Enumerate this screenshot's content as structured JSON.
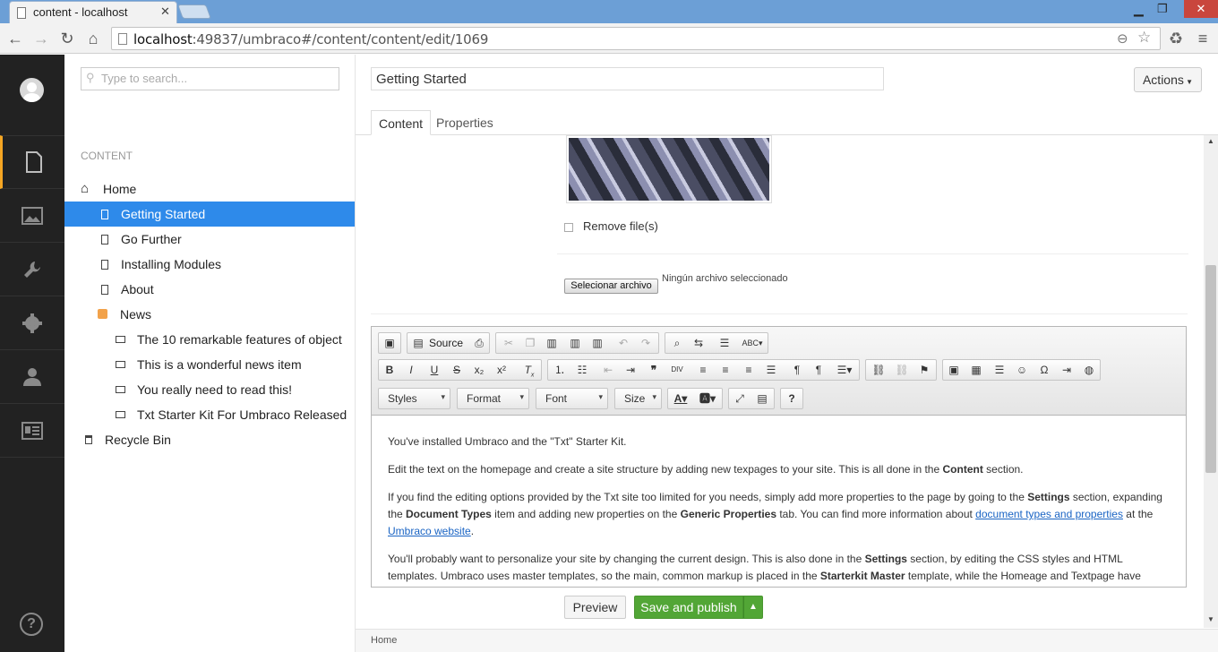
{
  "browser": {
    "tab_title": "content - localhost",
    "url_host": "localhost",
    "url_rest": ":49837/umbraco#/content/content/edit/1069"
  },
  "tree": {
    "search_placeholder": "Type to search...",
    "section_heading": "CONTENT",
    "items": [
      {
        "label": "Home",
        "icon": "home-icon"
      },
      {
        "label": "Getting Started",
        "icon": "document-icon"
      },
      {
        "label": "Go Further",
        "icon": "document-icon"
      },
      {
        "label": "Installing Modules",
        "icon": "document-icon"
      },
      {
        "label": "About",
        "icon": "document-icon"
      },
      {
        "label": "News",
        "icon": "news-icon"
      },
      {
        "label": "The 10 remarkable features of object",
        "icon": "picture-icon"
      },
      {
        "label": "This is a wonderful news item",
        "icon": "picture-icon"
      },
      {
        "label": "You really need to read this!",
        "icon": "picture-icon"
      },
      {
        "label": "Txt Starter Kit For Umbraco Released",
        "icon": "picture-icon"
      },
      {
        "label": "Recycle Bin",
        "icon": "trash-icon"
      }
    ]
  },
  "content": {
    "name": "Getting Started",
    "actions_label": "Actions",
    "tabs": [
      "Content",
      "Properties"
    ],
    "remove_files_label": "Remove file(s)",
    "file_button": "Selecionar archivo",
    "file_status": "Ningún archivo seleccionado"
  },
  "editor": {
    "source_label": "Source",
    "combos": [
      "Styles",
      "Format",
      "Font",
      "Size"
    ],
    "p1": "You've installed Umbraco and the \"Txt\" Starter Kit.",
    "p2_a": "Edit the text on the homepage and create a site structure by adding new texpages to your site. This is all done in the ",
    "p2_b": "Content",
    "p2_c": " section.",
    "p3_a": "If you find the editing options provided by the Txt site too limited for you needs, simply add more properties to the page by going to the ",
    "p3_b": "Settings",
    "p3_c": " section, expanding the ",
    "p3_d": "Document Types",
    "p3_e": " item and adding new properties on the ",
    "p3_f": "Generic Properties",
    "p3_g": " tab. You can find more information about ",
    "p3_link1": "document types and properties",
    "p3_h": " at the ",
    "p3_link2": "Umbraco website",
    "p3_i": ".",
    "p4_a": "You'll probably want to personalize your site by changing the current design. This is also done in the ",
    "p4_b": "Settings",
    "p4_c": " section, by editing the CSS styles and HTML templates. Umbraco uses master templates, so the main, common markup is placed in the ",
    "p4_d": "Starterkit Master",
    "p4_e": " template, while the Homeage and Textpage have"
  },
  "buttons": {
    "preview": "Preview",
    "save_publish": "Save and publish"
  },
  "status": {
    "breadcrumb": "Home"
  },
  "colors": {
    "accent": "#2e8aea",
    "save": "#52a636",
    "sidebar": "#222222",
    "active_section": "#f5a623"
  }
}
